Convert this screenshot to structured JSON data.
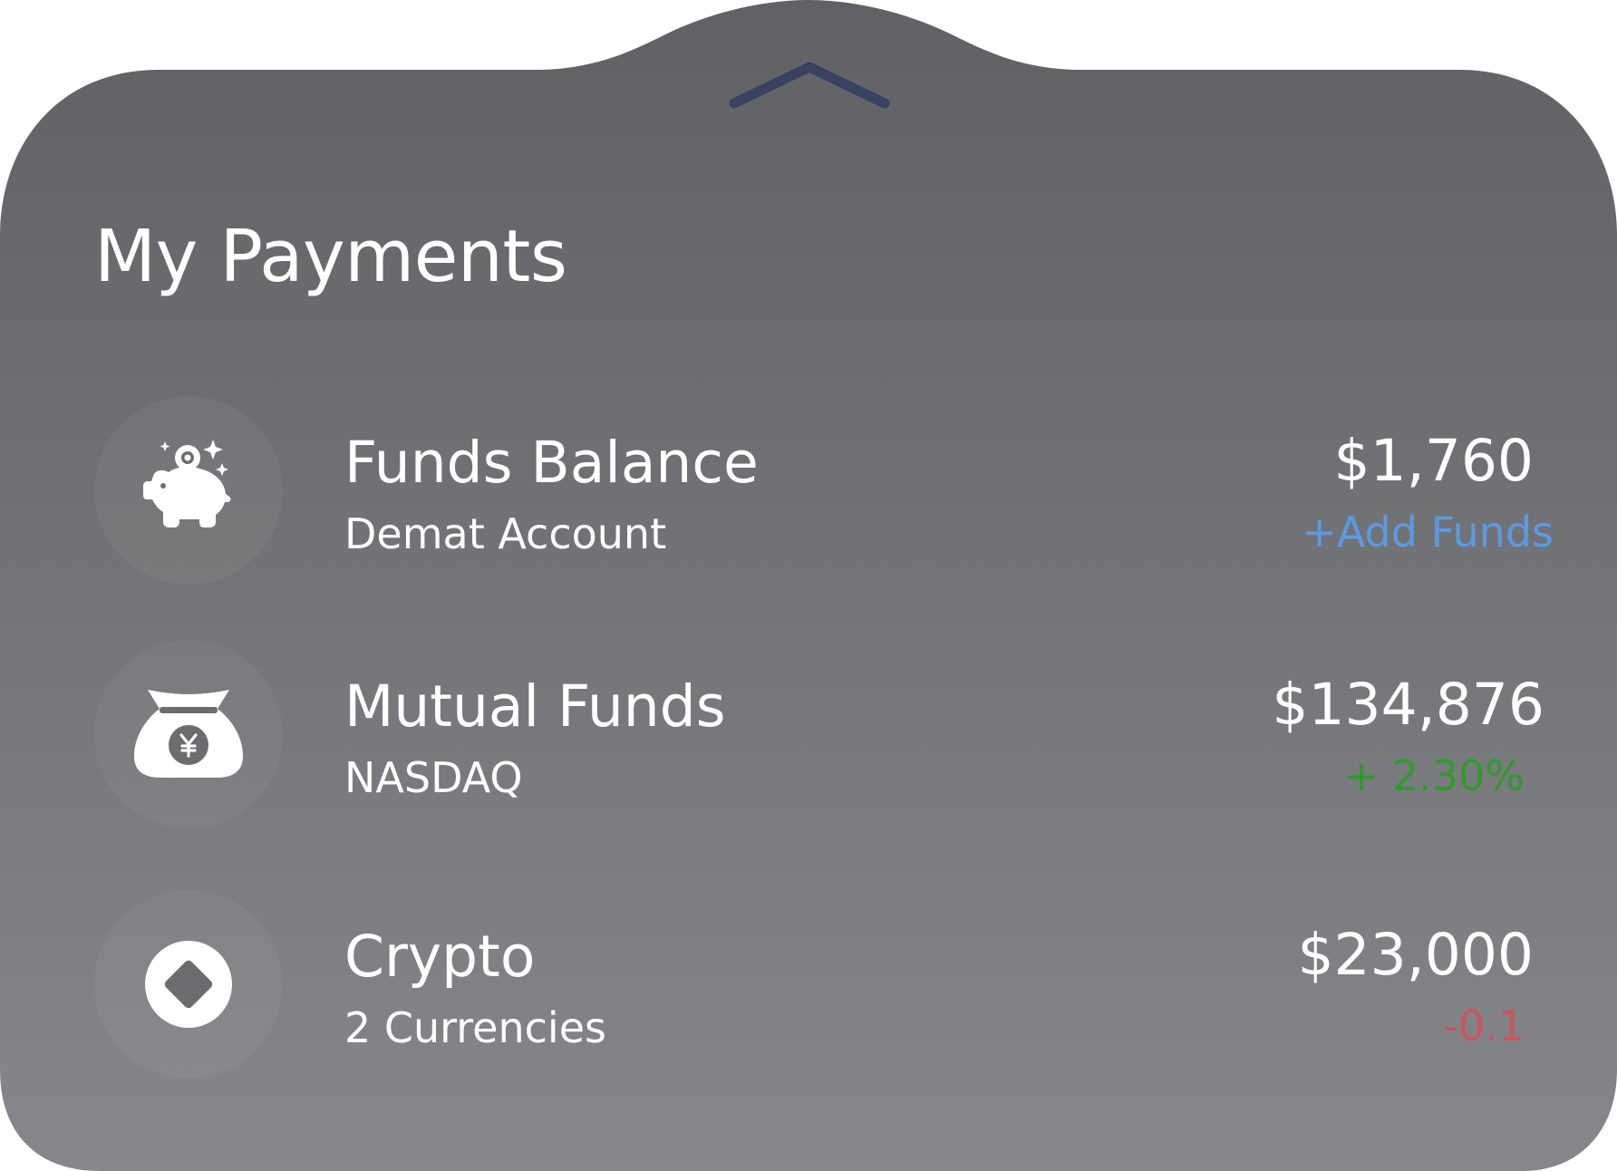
{
  "panel": {
    "title": "My Payments",
    "handle_icon": "chevron-up-icon"
  },
  "colors": {
    "panel_top": "#606164",
    "panel_bottom": "#86878a",
    "handle": "#394260",
    "link": "#5b9ae0",
    "positive": "#2f9a2c",
    "negative": "#c85560",
    "text": "#ffffff"
  },
  "items": [
    {
      "icon": "piggy-bank-icon",
      "title": "Funds Balance",
      "subtitle": "Demat Account",
      "amount": "$1,760",
      "action_label": "+Add Funds"
    },
    {
      "icon": "money-bag-icon",
      "title": "Mutual Funds",
      "subtitle": "NASDAQ",
      "amount": "$134,876",
      "change": "+ 2.30%"
    },
    {
      "icon": "crypto-coin-icon",
      "title": "Crypto",
      "subtitle": "2 Currencies",
      "amount": "$23,000",
      "change": "-0.1"
    }
  ]
}
